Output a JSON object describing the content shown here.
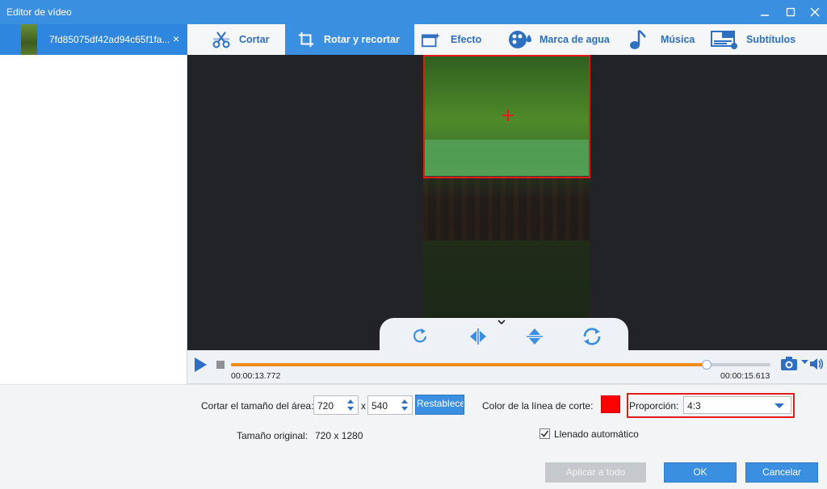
{
  "window": {
    "title": "Editor de vídeo",
    "minimize_icon": "minimize-icon",
    "maximize_icon": "maximize-icon",
    "close_icon": "close-icon"
  },
  "file_list": {
    "items": [
      {
        "name": "7fd85075df42ad94c65f1fa...",
        "close": "×"
      }
    ]
  },
  "tabs": [
    {
      "label": "Cortar",
      "icon": "scissors-icon"
    },
    {
      "label": "Rotar y recortar",
      "icon": "crop-icon",
      "active": true
    },
    {
      "label": "Efecto",
      "icon": "effect-icon"
    },
    {
      "label": "Marca de agua",
      "icon": "watermark-icon"
    },
    {
      "label": "Música",
      "icon": "music-icon"
    },
    {
      "label": "Subtítulos",
      "icon": "subtitles-icon"
    }
  ],
  "preview_tools": [
    "rotate-icon",
    "flip-horizontal-icon",
    "flip-vertical-icon",
    "reset-rotation-icon"
  ],
  "playback": {
    "current_time": "00:00:13.772",
    "end_time": "00:00:15.613",
    "progress": 0.882
  },
  "crop": {
    "area_label": "Cortar el tamaño del área:",
    "width": "720",
    "separator": "x",
    "height": "540",
    "reset_label": "Restablecer",
    "line_color_label": "Color de la línea de corte:",
    "line_color": "#ff0000",
    "ratio_label": "Proporción:",
    "ratio_value": "4:3",
    "original_label": "Tamaño original:",
    "original_value": "720 x 1280",
    "auto_fill_label": "Llenado automático",
    "auto_fill_checked": true
  },
  "footer": {
    "apply_all": "Aplicar a todo",
    "ok": "OK",
    "cancel": "Cancelar"
  },
  "colors": {
    "accent": "#3b8fe0",
    "progress": "#f08a1c",
    "highlight": "#e21b1b"
  }
}
